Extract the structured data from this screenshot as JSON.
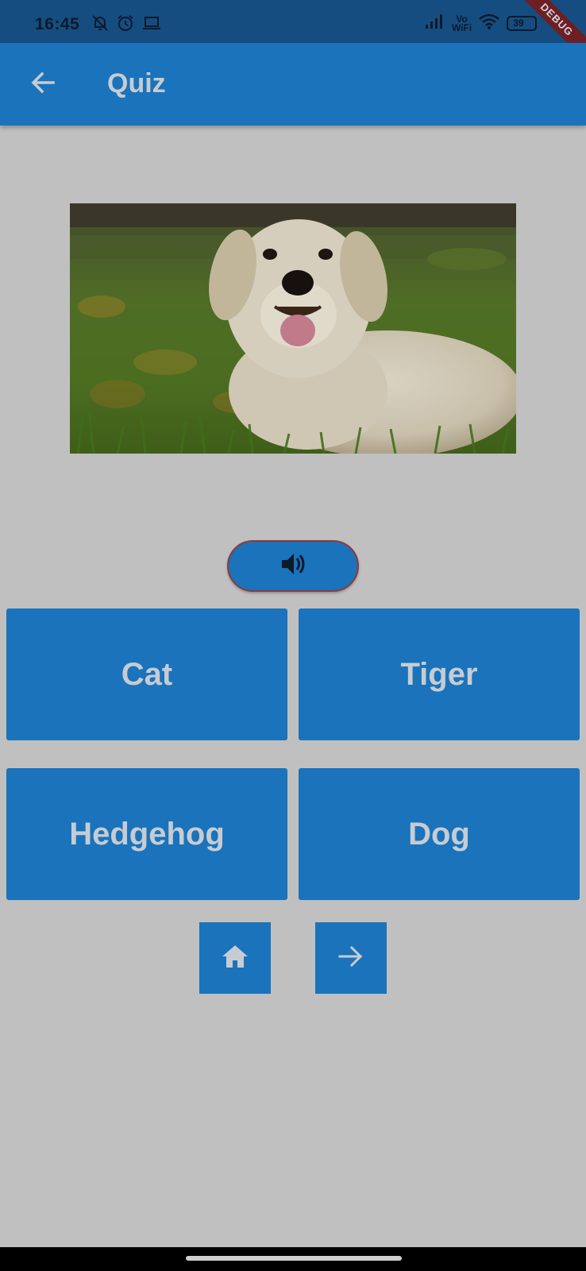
{
  "status_bar": {
    "time": "16:45",
    "volte_line1": "Vo",
    "volte_line2": "WiFi",
    "battery": "39",
    "debug_label": "DEBUG",
    "icons": [
      "bell-off-icon",
      "alarm-icon",
      "laptop-icon",
      "signal-icon",
      "wifi-icon",
      "battery-icon"
    ]
  },
  "app_bar": {
    "title": "Quiz",
    "back_icon": "arrow-left-icon"
  },
  "quiz": {
    "image_subject": "dog",
    "sound_icon": "volume-icon",
    "answers": [
      "Cat",
      "Tiger",
      "Hedgehog",
      "Dog"
    ]
  },
  "nav": {
    "home_icon": "home-icon",
    "next_icon": "arrow-right-icon"
  },
  "colors": {
    "primary": "#1a73bb",
    "status_bar": "#154d80",
    "background": "#c0c0c0",
    "button_text": "#c6ccd2",
    "sound_border": "#8e3a3a"
  }
}
